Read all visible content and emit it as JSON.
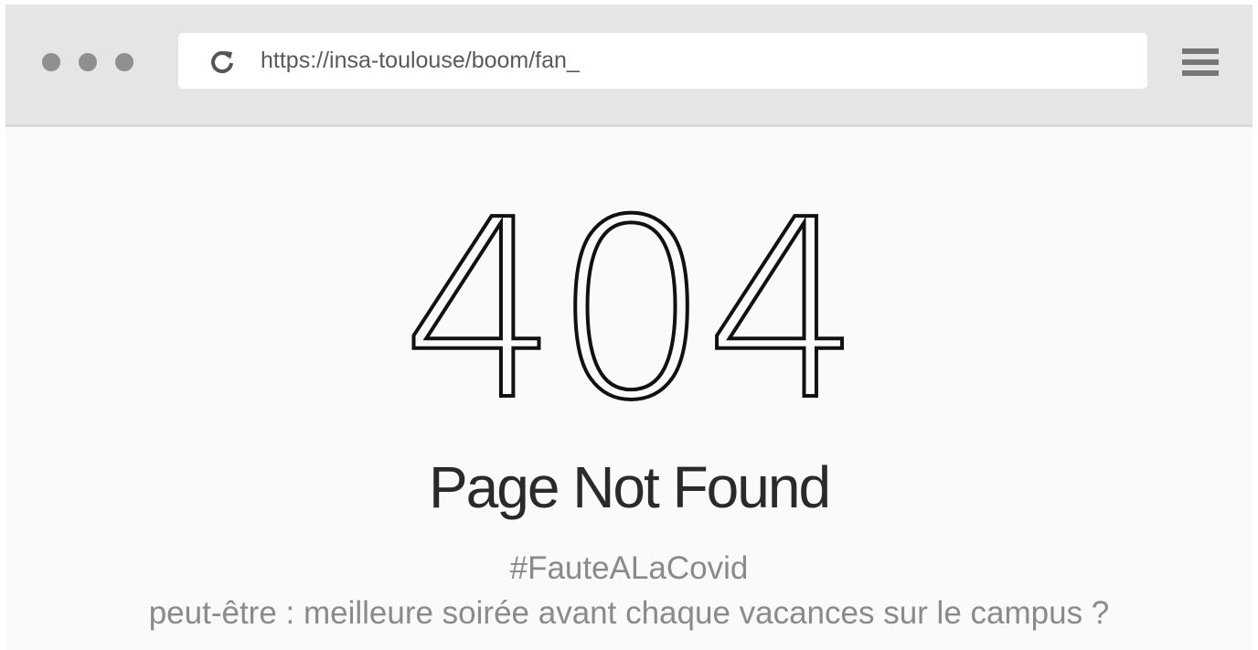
{
  "browser": {
    "window_controls": [
      "dot",
      "dot",
      "dot"
    ],
    "address_bar": {
      "url": "https://insa-toulouse/boom/fan_"
    },
    "icons": {
      "reload": "reload-icon",
      "menu": "hamburger-menu-icon"
    }
  },
  "page": {
    "error_code": "404",
    "title": "Page Not Found",
    "hashtag": "#FauteALaCovid",
    "note": "peut-être : meilleure soirée avant chaque vacances sur le campus ?"
  },
  "colors": {
    "toolbar": "#e5e5e5",
    "page_background": "#fafafa",
    "text_muted": "#8a8a8a"
  }
}
